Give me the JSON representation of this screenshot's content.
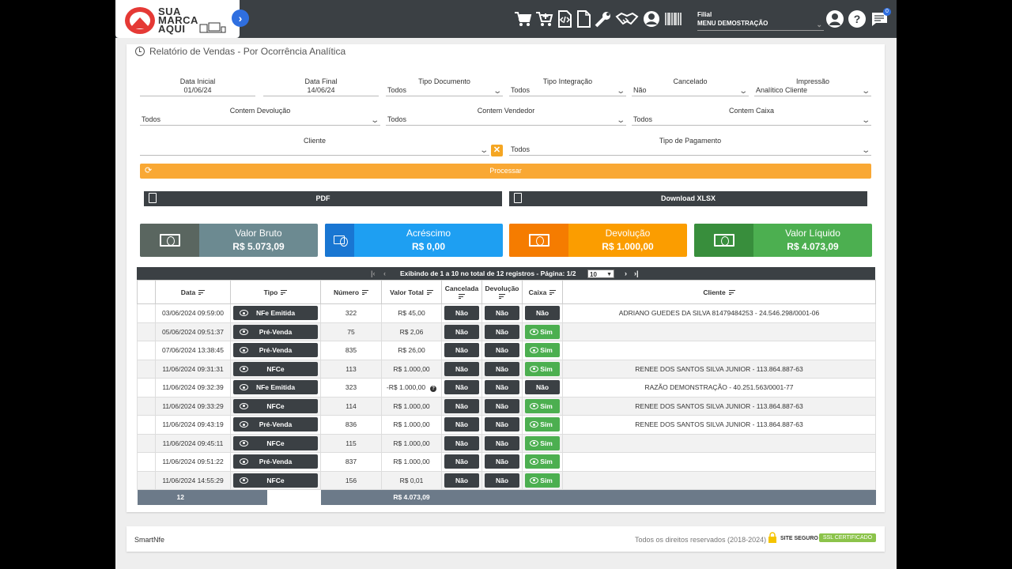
{
  "topbar": {
    "logo_text": [
      "SUA",
      "MARCA",
      "AQUI"
    ],
    "filial_label": "Filial",
    "filial_value": "MENU DEMOSTRAÇÃO",
    "notif_count": "0",
    "icons": [
      "cart-icon",
      "cart-add-icon",
      "code-file-icon",
      "file-icon",
      "wrench-icon",
      "handshake-icon",
      "user-circle-icon",
      "barcode-icon"
    ]
  },
  "page": {
    "title": "Relatório de Vendas - Por Ocorrência Analítica"
  },
  "filters": {
    "data_inicial": {
      "label": "Data Inicial",
      "value": "01/06/24"
    },
    "data_final": {
      "label": "Data Final",
      "value": "14/06/24"
    },
    "tipo_documento": {
      "label": "Tipo Documento",
      "value": "Todos"
    },
    "tipo_integracao": {
      "label": "Tipo Integração",
      "value": "Todos"
    },
    "cancelado": {
      "label": "Cancelado",
      "value": "Não"
    },
    "impressao": {
      "label": "Impressão",
      "value": "Analítico Cliente"
    },
    "contem_devolucao": {
      "label": "Contem Devolução",
      "value": "Todos"
    },
    "contem_vendedor": {
      "label": "Contem Vendedor",
      "value": "Todos"
    },
    "contem_caixa": {
      "label": "Contem Caixa",
      "value": "Todos"
    },
    "cliente": {
      "label": "Cliente",
      "value": ""
    },
    "tipo_pagamento": {
      "label": "Tipo de Pagamento",
      "value": "Todos"
    }
  },
  "actions": {
    "processar": "Processar",
    "pdf": "PDF",
    "xlsx": "Download XLSX"
  },
  "summary": [
    {
      "title": "Valor Bruto",
      "value": "R$ 5.073,09",
      "color": "#6c8a91",
      "icon_color": "#5a6660"
    },
    {
      "title": "Acréscimo",
      "value": "R$ 0,00",
      "color": "#1e9ff2",
      "icon_color": "#1976d2"
    },
    {
      "title": "Devolução",
      "value": "R$ 1.000,00",
      "color": "#fb9d00",
      "icon_color": "#f57c00"
    },
    {
      "title": "Valor Líquido",
      "value": "R$ 4.073,09",
      "color": "#4caf50",
      "icon_color": "#388e3c"
    }
  ],
  "pager": {
    "text": "Exibindo de 1 a 10 no total de 12 registros - Página: 1/2",
    "page_size": "10"
  },
  "table": {
    "headers": {
      "data": "Data",
      "tipo": "Tipo",
      "numero": "Número",
      "valor_total": "Valor Total",
      "cancelada": "Cancelada",
      "devolucao": "Devolução",
      "caixa": "Caixa",
      "cliente": "Cliente"
    },
    "rows": [
      {
        "data": "03/06/2024 09:59:00",
        "tipo": "NFe Emitida",
        "numero": "322",
        "valor": "R$ 45,00",
        "cancelada": "Não",
        "devolucao": "Não",
        "caixa": "Não",
        "cliente": "ADRIANO GUEDES DA SILVA 81479484253 - 24.546.298/0001-06"
      },
      {
        "data": "05/06/2024 09:51:37",
        "tipo": "Pré-Venda",
        "numero": "75",
        "valor": "R$ 2,06",
        "cancelada": "Não",
        "devolucao": "Não",
        "caixa": "Sim",
        "cliente": ""
      },
      {
        "data": "07/06/2024 13:38:45",
        "tipo": "Pré-Venda",
        "numero": "835",
        "valor": "R$ 26,00",
        "cancelada": "Não",
        "devolucao": "Não",
        "caixa": "Sim",
        "cliente": ""
      },
      {
        "data": "11/06/2024 09:31:31",
        "tipo": "NFCe",
        "numero": "113",
        "valor": "R$ 1.000,00",
        "cancelada": "Não",
        "devolucao": "Não",
        "caixa": "Sim",
        "cliente": "RENEE DOS SANTOS SILVA JUNIOR - 113.864.887-63"
      },
      {
        "data": "11/06/2024 09:32:39",
        "tipo": "NFe Emitida",
        "numero": "323",
        "valor": "-R$ 1.000,00",
        "cancelada": "Não",
        "devolucao": "Não",
        "caixa": "Não",
        "cliente": "RAZÃO DEMONSTRAÇÃO - 40.251.563/0001-77"
      },
      {
        "data": "11/06/2024 09:33:29",
        "tipo": "NFCe",
        "numero": "114",
        "valor": "R$ 1.000,00",
        "cancelada": "Não",
        "devolucao": "Não",
        "caixa": "Sim",
        "cliente": "RENEE DOS SANTOS SILVA JUNIOR - 113.864.887-63"
      },
      {
        "data": "11/06/2024 09:43:19",
        "tipo": "Pré-Venda",
        "numero": "836",
        "valor": "R$ 1.000,00",
        "cancelada": "Não",
        "devolucao": "Não",
        "caixa": "Sim",
        "cliente": "RENEE DOS SANTOS SILVA JUNIOR - 113.864.887-63"
      },
      {
        "data": "11/06/2024 09:45:11",
        "tipo": "NFCe",
        "numero": "115",
        "valor": "R$ 1.000,00",
        "cancelada": "Não",
        "devolucao": "Não",
        "caixa": "Sim",
        "cliente": ""
      },
      {
        "data": "11/06/2024 09:51:22",
        "tipo": "Pré-Venda",
        "numero": "837",
        "valor": "R$ 1.000,00",
        "cancelada": "Não",
        "devolucao": "Não",
        "caixa": "Sim",
        "cliente": ""
      },
      {
        "data": "11/06/2024 14:55:29",
        "tipo": "NFCe",
        "numero": "156",
        "valor": "R$ 0,01",
        "cancelada": "Não",
        "devolucao": "Não",
        "caixa": "Sim",
        "cliente": ""
      }
    ],
    "footer": {
      "count": "12",
      "total": "R$ 4.073,09"
    }
  },
  "footer": {
    "left": "SmartNfe",
    "right": "Todos os direitos reservados (2018-2024)",
    "site_seguro": "SITE SEGURO",
    "ssl": "SSL CERTIFICADO"
  }
}
